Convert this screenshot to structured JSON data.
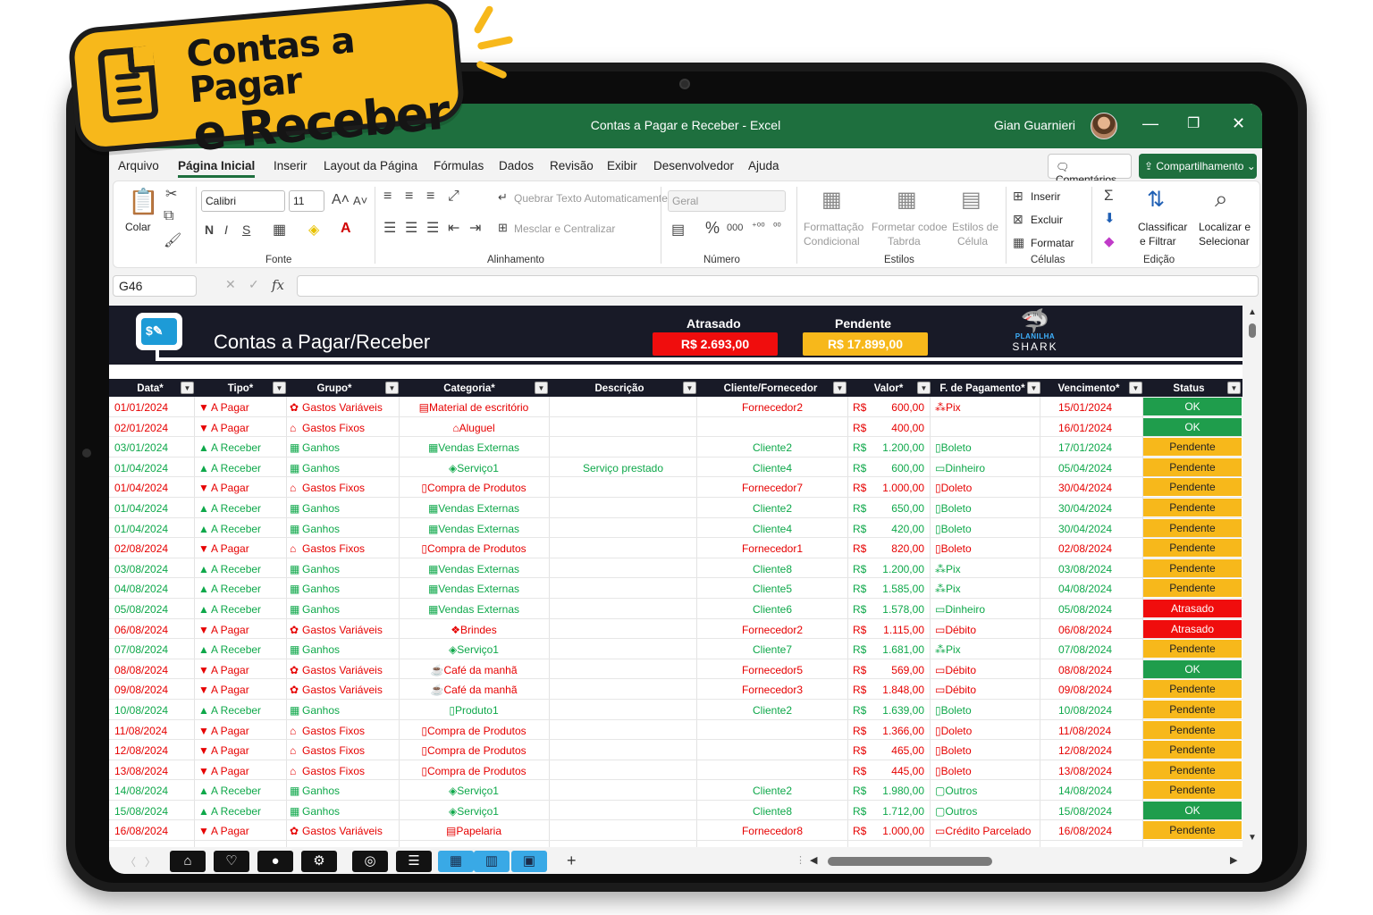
{
  "badge": {
    "line1": "Contas a Pagar",
    "line2": "e Receber"
  },
  "window": {
    "title": "Contas a Pagar e Receber  -  Excel",
    "user": "Gian Guarnieri",
    "minimize": "—",
    "restore": "❐",
    "close": "✕"
  },
  "menu": {
    "items": [
      "Arquivo",
      "Página Inicial",
      "Inserir",
      "Layout da Página",
      "Fórmulas",
      "Dados",
      "Revisão",
      "Exibir",
      "Desenvolvedor",
      "Ajuda"
    ],
    "comments": "Comentários",
    "share": "Compartilhamento"
  },
  "ribbon": {
    "paste": "Colar",
    "font_name": "Calibri",
    "font_size": "11",
    "bold": "N",
    "italic": "I",
    "underline": "S",
    "group_font": "Fonte",
    "wrap": "Quebrar Texto Automaticamente",
    "merge": "Mesclar e Centralizar",
    "group_align": "Alinhamento",
    "number_format": "Geral",
    "group_number": "Número",
    "cond_format": [
      "Formattação",
      "Condicional"
    ],
    "table_format": [
      "Formetar codoe",
      "Tabrda"
    ],
    "cell_styles": [
      "Estilos de",
      "Célula"
    ],
    "group_styles": "Estilos",
    "insert": "Inserir",
    "delete": "Excluir",
    "format": "Formatar",
    "group_cells": "Células",
    "sort": [
      "Classificar",
      "e Filtrar"
    ],
    "find": [
      "Localizar e",
      "Selecionar"
    ],
    "group_edit": "Edição"
  },
  "formula_bar": {
    "name_box": "G46",
    "fx": "fx",
    "value": ""
  },
  "sheet": {
    "title": "Contas a Pagar/Receber",
    "kpi_late_label": "Atrasado",
    "kpi_late_value": "R$ 2.693,00",
    "kpi_pending_label": "Pendente",
    "kpi_pending_value": "R$ 17.899,00",
    "logo_top": "PLANILHA",
    "logo_bottom": "SHARK",
    "colors": {
      "header": "#181a27",
      "red": "#e60000",
      "green": "#0ea84a",
      "ok": "#1f9d4c",
      "pending": "#f7b81b",
      "late": "#f00d0d"
    },
    "columns": [
      "Data*",
      "Tipo*",
      "Grupo*",
      "Categoria*",
      "Descrição",
      "Cliente/Fornecedor",
      "Valor*",
      "F. de Pagamento*",
      "Vencimento*",
      "Status"
    ],
    "rows": [
      {
        "k": "p",
        "data": "01/01/2024",
        "tipo": "A Pagar",
        "grupo": "Gastos Variáveis",
        "cat": "Material de escritório",
        "desc": "",
        "cli": "Fornecedor2",
        "cur": "R$",
        "valor": "600,00",
        "pag": "Pix",
        "venc": "15/01/2024",
        "status": "OK"
      },
      {
        "k": "p",
        "data": "02/01/2024",
        "tipo": "A Pagar",
        "grupo": "Gastos Fixos",
        "cat": "Aluguel",
        "desc": "",
        "cli": "",
        "cur": "R$",
        "valor": "400,00",
        "pag": "",
        "venc": "16/01/2024",
        "status": "OK"
      },
      {
        "k": "r",
        "data": "03/01/2024",
        "tipo": "A Receber",
        "grupo": "Ganhos",
        "cat": "Vendas Externas",
        "desc": "",
        "cli": "Cliente2",
        "cur": "R$",
        "valor": "1.200,00",
        "pag": "Boleto",
        "venc": "17/01/2024",
        "status": "Pendente"
      },
      {
        "k": "r",
        "data": "01/04/2024",
        "tipo": "A Receber",
        "grupo": "Ganhos",
        "cat": "Serviço1",
        "desc": "Serviço prestado",
        "cli": "Cliente4",
        "cur": "R$",
        "valor": "600,00",
        "pag": "Dinheiro",
        "venc": "05/04/2024",
        "status": "Pendente"
      },
      {
        "k": "p",
        "data": "01/04/2024",
        "tipo": "A Pagar",
        "grupo": "Gastos Fixos",
        "cat": "Compra de Produtos",
        "desc": "",
        "cli": "Fornecedor7",
        "cur": "R$",
        "valor": "1.000,00",
        "pag": "Doleto",
        "venc": "30/04/2024",
        "status": "Pendente"
      },
      {
        "k": "r",
        "data": "01/04/2024",
        "tipo": "A Receber",
        "grupo": "Ganhos",
        "cat": "Vendas Externas",
        "desc": "",
        "cli": "Cliente2",
        "cur": "R$",
        "valor": "650,00",
        "pag": "Boleto",
        "venc": "30/04/2024",
        "status": "Pendente"
      },
      {
        "k": "r",
        "data": "01/04/2024",
        "tipo": "A Receber",
        "grupo": "Ganhos",
        "cat": "Vendas Externas",
        "desc": "",
        "cli": "Cliente4",
        "cur": "R$",
        "valor": "420,00",
        "pag": "Boleto",
        "venc": "30/04/2024",
        "status": "Pendente"
      },
      {
        "k": "p",
        "data": "02/08/2024",
        "tipo": "A Pagar",
        "grupo": "Gastos Fixos",
        "cat": "Compra de Produtos",
        "desc": "",
        "cli": "Fornecedor1",
        "cur": "R$",
        "valor": "820,00",
        "pag": "Boleto",
        "venc": "02/08/2024",
        "status": "Pendente"
      },
      {
        "k": "r",
        "data": "03/08/2024",
        "tipo": "A Receber",
        "grupo": "Ganhos",
        "cat": "Vendas Externas",
        "desc": "",
        "cli": "Cliente8",
        "cur": "R$",
        "valor": "1.200,00",
        "pag": "Pix",
        "venc": "03/08/2024",
        "status": "Pendente"
      },
      {
        "k": "r",
        "data": "04/08/2024",
        "tipo": "A Receber",
        "grupo": "Ganhos",
        "cat": "Vendas Externas",
        "desc": "",
        "cli": "Cliente5",
        "cur": "R$",
        "valor": "1.585,00",
        "pag": "Pix",
        "venc": "04/08/2024",
        "status": "Pendente"
      },
      {
        "k": "r",
        "data": "05/08/2024",
        "tipo": "A Receber",
        "grupo": "Ganhos",
        "cat": "Vendas Externas",
        "desc": "",
        "cli": "Cliente6",
        "cur": "R$",
        "valor": "1.578,00",
        "pag": "Dinheiro",
        "venc": "05/08/2024",
        "status": "Atrasado"
      },
      {
        "k": "p",
        "data": "06/08/2024",
        "tipo": "A Pagar",
        "grupo": "Gastos Variáveis",
        "cat": "Brindes",
        "desc": "",
        "cli": "Fornecedor2",
        "cur": "R$",
        "valor": "1.115,00",
        "pag": "Débito",
        "venc": "06/08/2024",
        "status": "Atrasado"
      },
      {
        "k": "r",
        "data": "07/08/2024",
        "tipo": "A Receber",
        "grupo": "Ganhos",
        "cat": "Serviço1",
        "desc": "",
        "cli": "Cliente7",
        "cur": "R$",
        "valor": "1.681,00",
        "pag": "Pix",
        "venc": "07/08/2024",
        "status": "Pendente"
      },
      {
        "k": "p",
        "data": "08/08/2024",
        "tipo": "A Pagar",
        "grupo": "Gastos Variáveis",
        "cat": "Café da manhã",
        "desc": "",
        "cli": "Fornecedor5",
        "cur": "R$",
        "valor": "569,00",
        "pag": "Débito",
        "venc": "08/08/2024",
        "status": "OK"
      },
      {
        "k": "p",
        "data": "09/08/2024",
        "tipo": "A Pagar",
        "grupo": "Gastos Variáveis",
        "cat": "Café da manhã",
        "desc": "",
        "cli": "Fornecedor3",
        "cur": "R$",
        "valor": "1.848,00",
        "pag": "Débito",
        "venc": "09/08/2024",
        "status": "Pendente"
      },
      {
        "k": "r",
        "data": "10/08/2024",
        "tipo": "A Receber",
        "grupo": "Ganhos",
        "cat": "Produto1",
        "desc": "",
        "cli": "Cliente2",
        "cur": "R$",
        "valor": "1.639,00",
        "pag": "Boleto",
        "venc": "10/08/2024",
        "status": "Pendente"
      },
      {
        "k": "p",
        "data": "11/08/2024",
        "tipo": "A Pagar",
        "grupo": "Gastos Fixos",
        "cat": "Compra de Produtos",
        "desc": "",
        "cli": "",
        "cur": "R$",
        "valor": "1.366,00",
        "pag": "Doleto",
        "venc": "11/08/2024",
        "status": "Pendente"
      },
      {
        "k": "p",
        "data": "12/08/2024",
        "tipo": "A Pagar",
        "grupo": "Gastos Fixos",
        "cat": "Compra de Produtos",
        "desc": "",
        "cli": "",
        "cur": "R$",
        "valor": "465,00",
        "pag": "Boleto",
        "venc": "12/08/2024",
        "status": "Pendente"
      },
      {
        "k": "p",
        "data": "13/08/2024",
        "tipo": "A Pagar",
        "grupo": "Gastos Fixos",
        "cat": "Compra de Produtos",
        "desc": "",
        "cli": "",
        "cur": "R$",
        "valor": "445,00",
        "pag": "Boleto",
        "venc": "13/08/2024",
        "status": "Pendente"
      },
      {
        "k": "r",
        "data": "14/08/2024",
        "tipo": "A Receber",
        "grupo": "Ganhos",
        "cat": "Serviço1",
        "desc": "",
        "cli": "Cliente2",
        "cur": "R$",
        "valor": "1.980,00",
        "pag": "Outros",
        "venc": "14/08/2024",
        "status": "Pendente"
      },
      {
        "k": "r",
        "data": "15/08/2024",
        "tipo": "A Receber",
        "grupo": "Ganhos",
        "cat": "Serviço1",
        "desc": "",
        "cli": "Cliente8",
        "cur": "R$",
        "valor": "1.712,00",
        "pag": "Outros",
        "venc": "15/08/2024",
        "status": "OK"
      },
      {
        "k": "p",
        "data": "16/08/2024",
        "tipo": "A Pagar",
        "grupo": "Gastos Variáveis",
        "cat": "Papelaria",
        "desc": "",
        "cli": "Fornecedor8",
        "cur": "R$",
        "valor": "1.000,00",
        "pag": "Crédito Parcelado",
        "venc": "16/08/2024",
        "status": "Pendente"
      }
    ]
  },
  "tabs": {
    "icons": [
      "home-icon",
      "handshake-icon",
      "user-icon",
      "gear-icon",
      "target-icon",
      "list-icon",
      "calendar-icon",
      "chart-icon",
      "dashboard-icon"
    ],
    "add": "+"
  }
}
